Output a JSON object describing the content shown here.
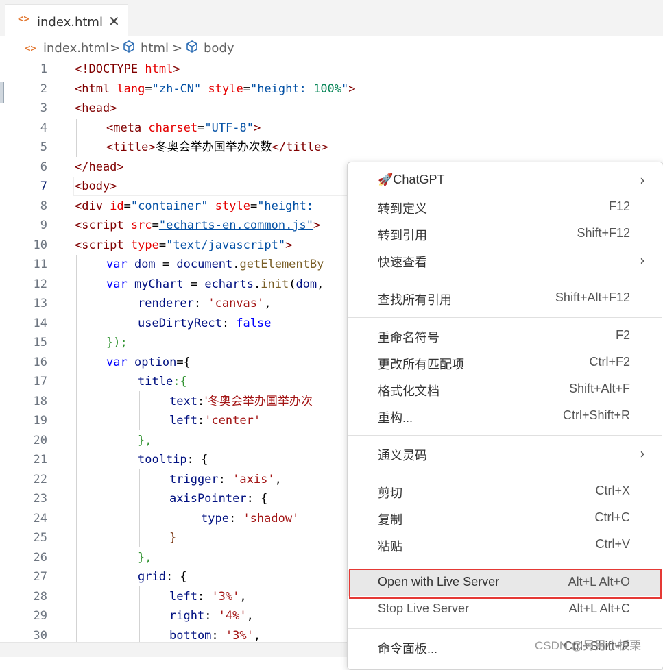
{
  "tab": {
    "icon": "<>",
    "title": "index.html",
    "close": "✕"
  },
  "breadcrumb": {
    "file_icon": "<>",
    "file": "index.html",
    "sep": ">",
    "item1": "html",
    "item2": "body"
  },
  "editor": {
    "line_numbers": [
      "1",
      "2",
      "3",
      "4",
      "5",
      "6",
      "7",
      "8",
      "9",
      "10",
      "11",
      "12",
      "13",
      "14",
      "15",
      "16",
      "17",
      "18",
      "19",
      "20",
      "21",
      "22",
      "23",
      "24",
      "25",
      "26",
      "27",
      "28",
      "29",
      "30"
    ],
    "active_line": "7",
    "code": {
      "l1": [
        "<!DOCTYPE",
        " html",
        ">"
      ],
      "l2": [
        "<html",
        " lang",
        "=",
        "\"zh-CN\"",
        " style",
        "=",
        "\"height: ",
        "100%",
        "\"",
        ">"
      ],
      "l3": [
        "<head>"
      ],
      "l4": [
        "<meta",
        " charset",
        "=",
        "\"UTF-8\"",
        ">"
      ],
      "l5": [
        "<title>",
        "冬奥会举办国举办次数",
        "</title>"
      ],
      "l6": [
        "</head>"
      ],
      "l7": [
        "<body>"
      ],
      "l8": [
        "<div",
        " id",
        "=",
        "\"container\"",
        " style",
        "=",
        "\"height:"
      ],
      "l9": [
        "<script",
        " src",
        "=",
        "\"echarts-en.common.js\"",
        ">"
      ],
      "l10": [
        "<script",
        " type",
        "=",
        "\"text/javascript\"",
        ">"
      ],
      "l11": [
        "var",
        " dom",
        " = ",
        "document",
        ".",
        "getElementBy"
      ],
      "l12": [
        "var",
        " myChart",
        " = ",
        "echarts",
        ".",
        "init",
        "(",
        "dom",
        ","
      ],
      "l13": [
        "renderer",
        ": ",
        "'canvas'",
        ","
      ],
      "l14": [
        "useDirtyRect",
        ": ",
        "false"
      ],
      "l15": [
        "});"
      ],
      "l16": [
        "var",
        " option",
        "={"
      ],
      "l17": [
        "title",
        ":{"
      ],
      "l18": [
        "text",
        ":",
        "'冬奥会举办国举办次"
      ],
      "l19": [
        "left",
        ":",
        "'center'"
      ],
      "l20": [
        "},"
      ],
      "l21": [
        "tooltip",
        ": {"
      ],
      "l22": [
        "trigger",
        ": ",
        "'axis'",
        ","
      ],
      "l23": [
        "axisPointer",
        ": {"
      ],
      "l24": [
        "type",
        ": ",
        "'shadow'"
      ],
      "l25": [
        "}"
      ],
      "l26": [
        "},"
      ],
      "l27": [
        "grid",
        ": {"
      ],
      "l28": [
        "left",
        ": ",
        "'3%'",
        ","
      ],
      "l29": [
        "right",
        ": ",
        "'4%'",
        ","
      ],
      "l30": [
        "bottom",
        ": ",
        "'3%'",
        ","
      ]
    }
  },
  "context_menu": {
    "items": [
      {
        "icon": "🚀",
        "label": "ChatGPT",
        "shortcut": "",
        "arrow": "›"
      },
      {
        "label": "转到定义",
        "shortcut": "F12"
      },
      {
        "label": "转到引用",
        "shortcut": "Shift+F12"
      },
      {
        "label": "快速查看",
        "shortcut": "",
        "arrow": "›"
      },
      {
        "label": "查找所有引用",
        "shortcut": "Shift+Alt+F12"
      },
      {
        "label": "重命名符号",
        "shortcut": "F2"
      },
      {
        "label": "更改所有匹配项",
        "shortcut": "Ctrl+F2"
      },
      {
        "label": "格式化文档",
        "shortcut": "Shift+Alt+F"
      },
      {
        "label": "重构...",
        "shortcut": "Ctrl+Shift+R"
      },
      {
        "label": "通义灵码",
        "shortcut": "",
        "arrow": "›"
      },
      {
        "label": "剪切",
        "shortcut": "Ctrl+X"
      },
      {
        "label": "复制",
        "shortcut": "Ctrl+C"
      },
      {
        "label": "粘贴",
        "shortcut": "Ctrl+V"
      },
      {
        "label": "Open with Live Server",
        "shortcut": "Alt+L Alt+O"
      },
      {
        "label": "Stop Live Server",
        "shortcut": "Alt+L Alt+C"
      },
      {
        "label": "命令面板...",
        "shortcut": "Ctrl+Shift+P"
      }
    ]
  },
  "watermark": "CSDN @另另小板栗",
  "colors": {
    "highlight_border": "#e53935",
    "tag": "#800000",
    "attr": "#e50000",
    "string": "#0451a5",
    "keyword": "#0000ff"
  }
}
